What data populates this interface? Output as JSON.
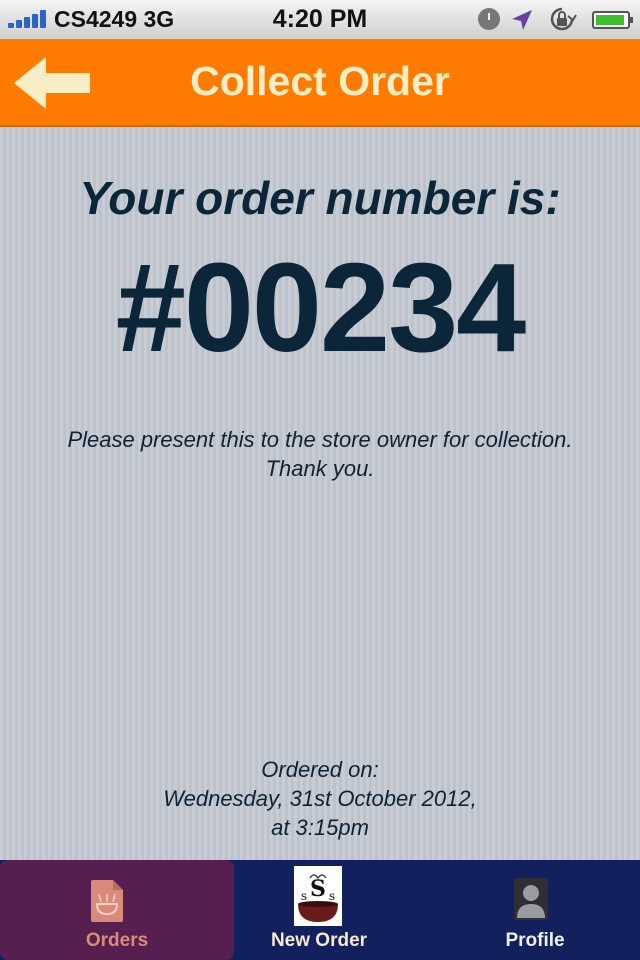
{
  "status_bar": {
    "carrier": "CS4249 3G",
    "time": "4:20 PM",
    "icons": [
      "signal-icon",
      "alarm-icon",
      "location-icon",
      "rotation-lock-icon",
      "battery-icon"
    ]
  },
  "nav_bar": {
    "title": "Collect Order",
    "back_icon": "back-arrow-icon",
    "accent_color": "#ff7a00"
  },
  "content": {
    "heading": "Your order number is:",
    "order_number": "#00234",
    "instructions_line1": "Please present this to the store owner for collection.",
    "instructions_line2": "Thank you.",
    "ordered_on_label": "Ordered on:",
    "ordered_on_date": "Wednesday, 31st October 2012,",
    "ordered_on_time": "at 3:15pm"
  },
  "tab_bar": {
    "tabs": [
      {
        "label": "Orders",
        "icon": "orders-icon",
        "selected": true
      },
      {
        "label": "New Order",
        "icon": "new-order-icon",
        "selected": false
      },
      {
        "label": "Profile",
        "icon": "profile-icon",
        "selected": false
      }
    ],
    "background_color": "#13205e",
    "selected_color": "#561f4f"
  }
}
